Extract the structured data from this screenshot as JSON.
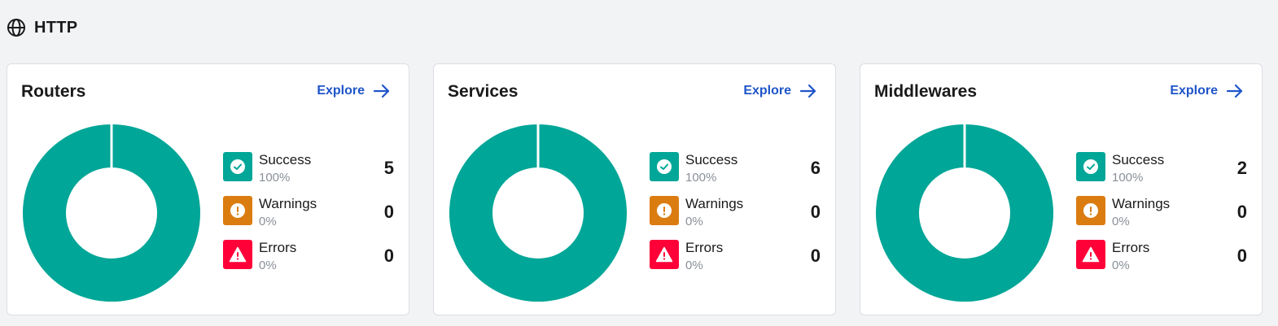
{
  "section": {
    "title": "HTTP",
    "icon": "globe-icon"
  },
  "colors": {
    "success": "#00a697",
    "warning": "#db7c10",
    "error": "#ff0039",
    "link": "#1f55c9"
  },
  "cards": [
    {
      "title": "Routers",
      "explore_label": "Explore",
      "stats": [
        {
          "name": "Success",
          "pct": "100%",
          "count": "5"
        },
        {
          "name": "Warnings",
          "pct": "0%",
          "count": "0"
        },
        {
          "name": "Errors",
          "pct": "0%",
          "count": "0"
        }
      ]
    },
    {
      "title": "Services",
      "explore_label": "Explore",
      "stats": [
        {
          "name": "Success",
          "pct": "100%",
          "count": "6"
        },
        {
          "name": "Warnings",
          "pct": "0%",
          "count": "0"
        },
        {
          "name": "Errors",
          "pct": "0%",
          "count": "0"
        }
      ]
    },
    {
      "title": "Middlewares",
      "explore_label": "Explore",
      "stats": [
        {
          "name": "Success",
          "pct": "100%",
          "count": "2"
        },
        {
          "name": "Warnings",
          "pct": "0%",
          "count": "0"
        },
        {
          "name": "Errors",
          "pct": "0%",
          "count": "0"
        }
      ]
    }
  ]
}
